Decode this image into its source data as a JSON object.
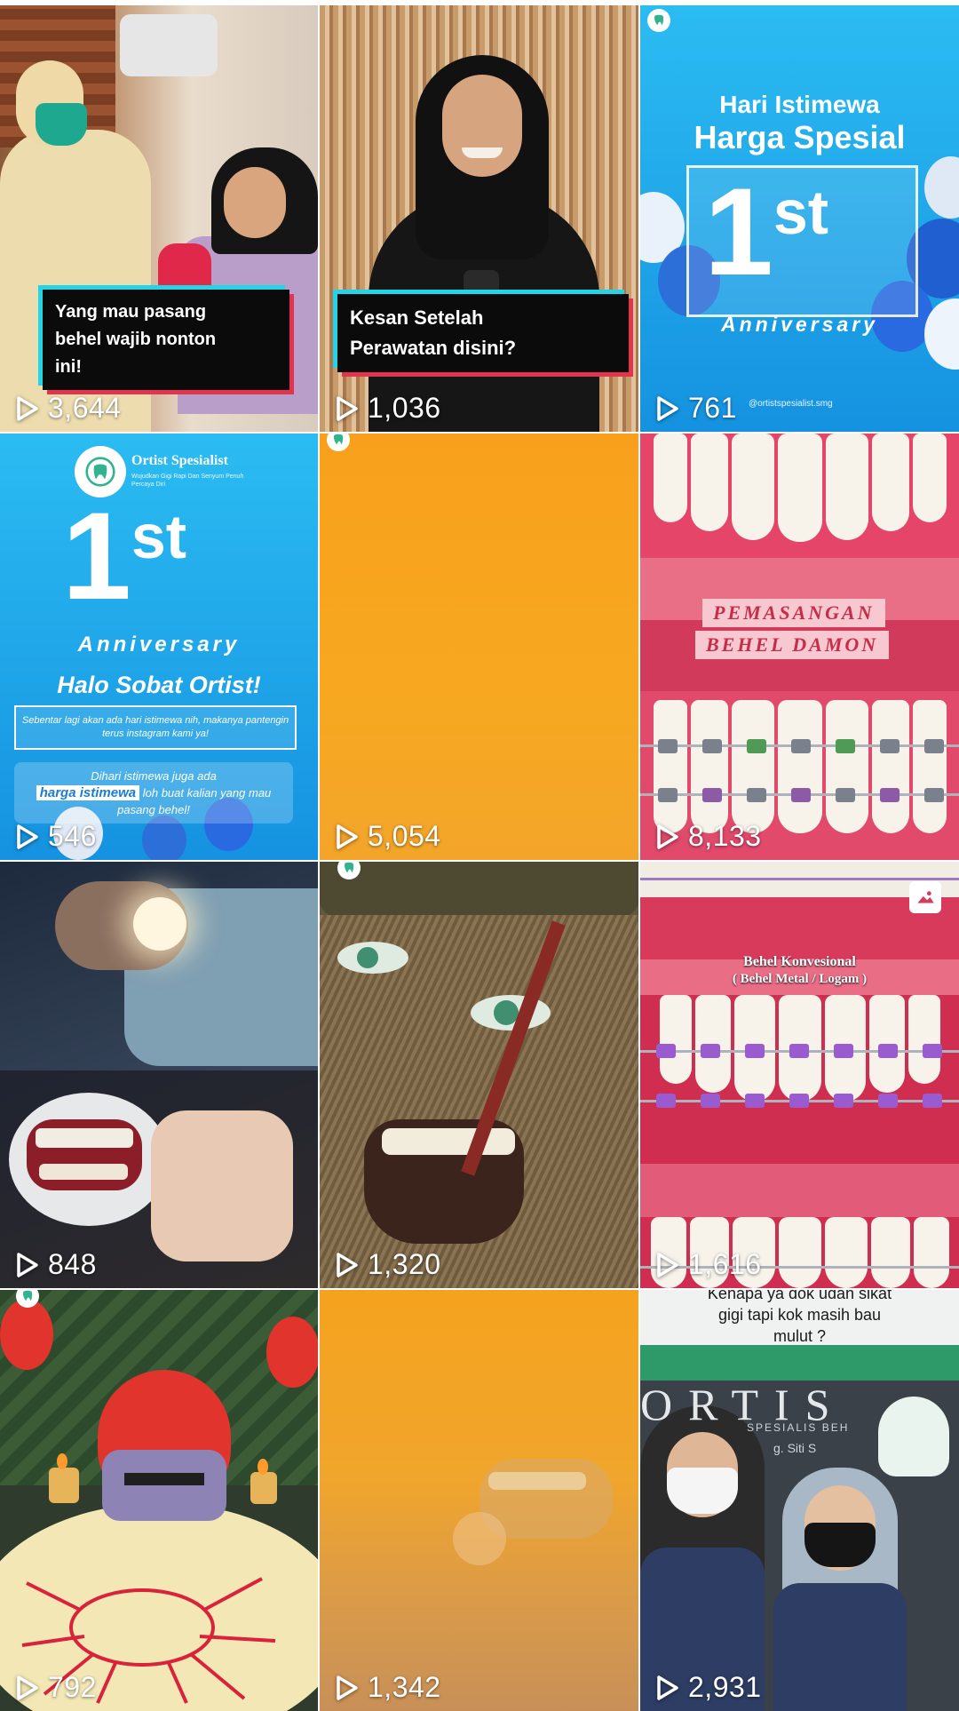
{
  "tiles": [
    {
      "views": "3,644",
      "caption_lines": [
        "Yang mau pasang",
        "behel wajib nonton",
        "ini!"
      ]
    },
    {
      "views": "1,036",
      "caption_lines": [
        "Kesan Setelah",
        "Perawatan disini?"
      ]
    },
    {
      "views": "761",
      "line1": "Hari Istimewa",
      "line2": "Harga Spesial",
      "num": "1",
      "suffix": "st",
      "anniversary": "Anniversary",
      "handle": "@ortistspesialist.smg"
    },
    {
      "views": "546",
      "brand": "Ortist Spesialist",
      "tagline": "Wujudkan Gigi Rapi Dan Senyum Penuh Percaya Diri",
      "num": "1",
      "suffix": "st",
      "anniversary": "Anniversary",
      "greeting": "Halo Sobat Ortist!",
      "body1": "Sebentar lagi akan ada hari istimewa nih, makanya pantengin terus instagram kami ya!",
      "body2_pre": "Dihari istimewa juga ada",
      "body2_highlight": "harga istimewa",
      "body2_post": "loh buat kalian yang mau pasang behel!"
    },
    {
      "views": "5,054"
    },
    {
      "views": "8,133",
      "label1": "PEMASANGAN",
      "label2": "BEHEL DAMON"
    },
    {
      "views": "848"
    },
    {
      "views": "1,320"
    },
    {
      "views": "1,616",
      "title1": "Behel Konvesional",
      "title2": "( Behel Metal / Logam )"
    },
    {
      "views": "792"
    },
    {
      "views": "1,342"
    },
    {
      "views": "2,931",
      "caption1": "Kenapa ya dok udah sikat",
      "caption2": "gigi tapi kok masih bau",
      "caption3": "mulut ?",
      "sign": "ORTIS",
      "sign_sub": "SPESIALIS BEH",
      "sign_name": "g. Siti S"
    }
  ],
  "colors": {
    "brand_teal": "#22d4e6",
    "brand_red": "#e2344f",
    "orange": "#f7a51f",
    "blue": "#1e9fe8"
  },
  "icons": {
    "play": "play-icon",
    "gallery": "gallery-icon",
    "brand": "tooth-logo-icon"
  }
}
